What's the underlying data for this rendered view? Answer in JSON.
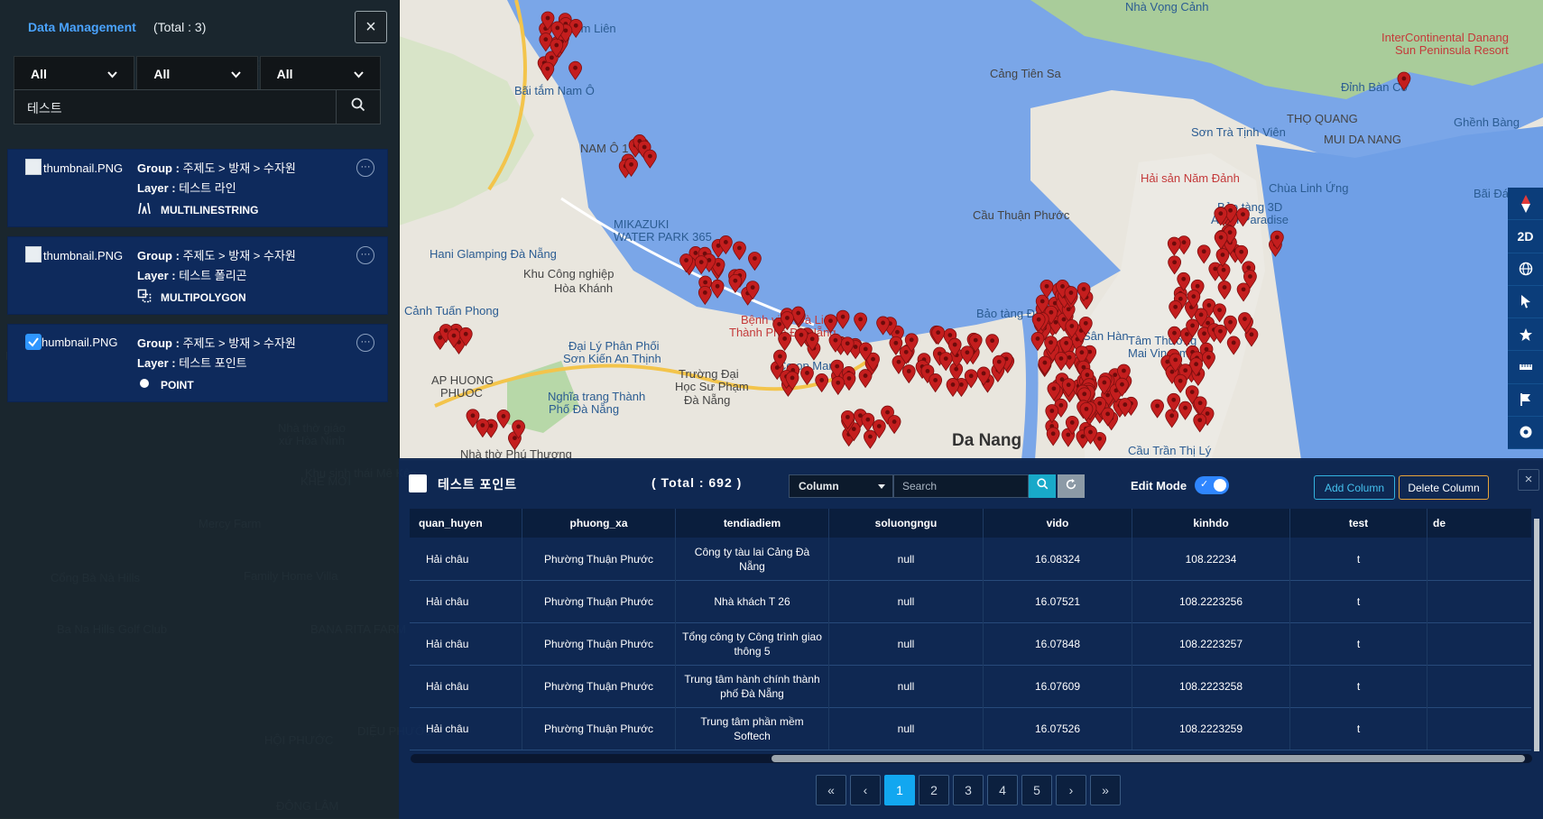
{
  "map": {
    "labels": [
      {
        "text": "Nhà Vọng Cảnh",
        "cls": ""
      },
      {
        "text": "InterContinental Danang",
        "cls": "red"
      },
      {
        "text": "Sun Peninsula Resort",
        "cls": "red"
      },
      {
        "text": "Cảng Tiên Sa",
        "cls": "dark"
      },
      {
        "text": "Đỉnh Bàn Cờ",
        "cls": ""
      },
      {
        "text": "Ghềnh Bàng",
        "cls": ""
      },
      {
        "text": "THỌ QUANG",
        "cls": "dark"
      },
      {
        "text": "MUI DA NANG",
        "cls": "dark"
      },
      {
        "text": "Sơn Trà Tịnh Viên",
        "cls": ""
      },
      {
        "text": "Hải sản Năm Đảnh",
        "cls": "red"
      },
      {
        "text": "Chùa Linh Ứng",
        "cls": ""
      },
      {
        "text": "Bãi Đá",
        "cls": ""
      },
      {
        "text": "Bảo tàng 3D",
        "cls": ""
      },
      {
        "text": "Art In Paradise",
        "cls": ""
      },
      {
        "text": "Cầu Thuận Phước",
        "cls": "dark"
      },
      {
        "text": "Bãi tắm Nam Ô",
        "cls": ""
      },
      {
        "text": "ga Kim Liên",
        "cls": ""
      },
      {
        "text": "NAM Ô 1",
        "cls": "dark"
      },
      {
        "text": "MIKAZUKI",
        "cls": ""
      },
      {
        "text": "WATER PARK 365",
        "cls": ""
      },
      {
        "text": "Hani Glamping Đà Nẵng",
        "cls": ""
      },
      {
        "text": "Khu Công nghiệp",
        "cls": "dark"
      },
      {
        "text": "Hòa Khánh",
        "cls": "dark"
      },
      {
        "text": "Cảnh Tuấn Phong",
        "cls": ""
      },
      {
        "text": "Bệnh viện Đà Liên",
        "cls": "red"
      },
      {
        "text": "Thành Phố Đà Nẵng",
        "cls": "red"
      },
      {
        "text": "Đại Lý Phân Phối",
        "cls": ""
      },
      {
        "text": "Sơn Kiến An Thịnh",
        "cls": ""
      },
      {
        "text": "Trường Đại",
        "cls": "dark"
      },
      {
        "text": "Học Sư Phạm",
        "cls": "dark"
      },
      {
        "text": "Đà Nẵng",
        "cls": "dark"
      },
      {
        "text": "Co.op Mart",
        "cls": ""
      },
      {
        "text": "Bảo tàng Đà Nẵng",
        "cls": ""
      },
      {
        "text": "Sân Hàn",
        "cls": ""
      },
      {
        "text": "Tâm Thương",
        "cls": ""
      },
      {
        "text": "Mai Vincom",
        "cls": ""
      },
      {
        "text": "AP HUONG",
        "cls": "dark"
      },
      {
        "text": "PHUOC",
        "cls": "dark"
      },
      {
        "text": "Nghĩa trang Thành",
        "cls": ""
      },
      {
        "text": "Phố Đà Nẵng",
        "cls": ""
      },
      {
        "text": "Nhà thờ Phú Thượng",
        "cls": "dark"
      },
      {
        "text": "Da Nang",
        "cls": "city"
      },
      {
        "text": "Cầu Trần Thị Lý",
        "cls": ""
      },
      {
        "text": "Khu sinh thái Mê Kên",
        "cls": "faint"
      },
      {
        "text": "KHE MỚI",
        "cls": "faint"
      },
      {
        "text": "Mercy Farm",
        "cls": "faint"
      },
      {
        "text": "Family Home Villa",
        "cls": "faint"
      },
      {
        "text": "Cổng Bà Nà Hills",
        "cls": "faint"
      },
      {
        "text": "Ba Na Hills Golf Club",
        "cls": "faint"
      },
      {
        "text": "BANA RITA FARM",
        "cls": "faint"
      },
      {
        "text": "Nhà thờ giáo",
        "cls": "faint"
      },
      {
        "text": "xứ Hòa Ninh",
        "cls": "faint"
      },
      {
        "text": "ND xã Hòa",
        "cls": "faint"
      },
      {
        "text": "Farm Đà Nẵng",
        "cls": "faint"
      },
      {
        "text": "HỘI PHƯỚC",
        "cls": "faint"
      },
      {
        "text": "DIỆU PHƯỚC",
        "cls": "faint"
      },
      {
        "text": "ĐÔNG LÂM",
        "cls": "faint"
      }
    ]
  },
  "panel": {
    "title": "Data Management",
    "total": "(Total : 3)",
    "close_icon": "×",
    "filters": [
      "All",
      "All",
      "All"
    ],
    "search_value": "테스트",
    "cards": [
      {
        "thumb": "thumbnail.PNG",
        "group_label": "Group :",
        "group": "주제도 > 방재 > 수자원",
        "layer_label": "Layer :",
        "layer": "테스트 라인",
        "geometry": "MULTILINESTRING",
        "icon": "multilinestring-icon",
        "checked": false
      },
      {
        "thumb": "thumbnail.PNG",
        "group_label": "Group :",
        "group": "주제도 > 방재 > 수자원",
        "layer_label": "Layer :",
        "layer": "테스트 폴리곤",
        "geometry": "MULTIPOLYGON",
        "icon": "multipolygon-icon",
        "checked": false
      },
      {
        "thumb": "humbnail.PNG",
        "group_label": "Group :",
        "group": "주제도 > 방재 > 수자원",
        "layer_label": "Layer :",
        "layer": "테스트 포인트",
        "geometry": "POINT",
        "icon": "point-icon",
        "checked": true
      }
    ]
  },
  "toolbar": {
    "items": [
      "compass-icon",
      "2D",
      "globe-icon",
      "pointer-icon",
      "star-icon",
      "ruler-icon",
      "flag-icon",
      "target-icon"
    ]
  },
  "table": {
    "title": "테스트 포인트",
    "total": "( Total : 692 )",
    "column_select": "Column",
    "search_placeholder": "Search",
    "edit_mode_label": "Edit Mode",
    "add_column": "Add Column",
    "delete_column": "Delete Column",
    "close_icon": "×",
    "columns": [
      "quan_huyen",
      "phuong_xa",
      "tendiadiem",
      "soluongngu",
      "vido",
      "kinhdo",
      "test",
      "de"
    ],
    "rows": [
      [
        "Hải châu",
        "Phường Thuận Phước",
        "Công ty tàu lai Cảng Đà Nẵng",
        "null",
        "16.08324",
        "108.22234",
        "t"
      ],
      [
        "Hải châu",
        "Phường Thuận Phước",
        "Nhà khách T 26",
        "null",
        "16.07521",
        "108.2223256",
        "t"
      ],
      [
        "Hải châu",
        "Phường Thuận Phước",
        "Tổng công ty Công trình giao thông 5",
        "null",
        "16.07848",
        "108.2223257",
        "t"
      ],
      [
        "Hải châu",
        "Phường Thuận Phước",
        "Trung tâm hành chính thành phố Đà Nẵng",
        "null",
        "16.07609",
        "108.2223258",
        "t"
      ],
      [
        "Hải châu",
        "Phường Thuận Phước",
        "Trung tâm phần mềm Softech",
        "null",
        "16.07526",
        "108.2223259",
        "t"
      ]
    ],
    "pager": [
      "«",
      "‹",
      "1",
      "2",
      "3",
      "4",
      "5",
      "›",
      "»"
    ],
    "active_page": "1"
  }
}
